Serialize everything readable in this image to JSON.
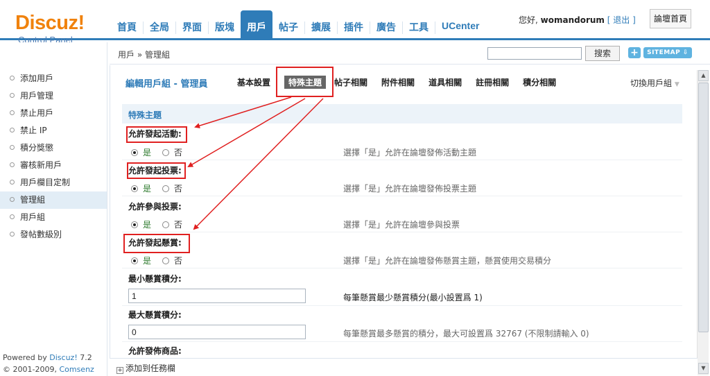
{
  "header": {
    "logo_main": "Discuz!",
    "logo_sub": "Control Panel",
    "nav": [
      "首頁",
      "全局",
      "界面",
      "版塊",
      "用戶",
      "帖子",
      "擴展",
      "插件",
      "廣告",
      "工具",
      "UCenter"
    ],
    "greeting": "您好,",
    "username": "womandorum",
    "logout": "[ 退出 ]",
    "home_button": "論壇首頁"
  },
  "subbar": {
    "breadcrumb": "用戶 » 管理組",
    "search_button": "搜索",
    "plus_button": "+",
    "sitemap_button": "SITEMAP ⇩"
  },
  "sidebar": {
    "items": [
      "添加用戶",
      "用戶管理",
      "禁止用戶",
      "禁止 IP",
      "積分獎懲",
      "審核新用戶",
      "用戶欄目定制",
      "管理組",
      "用戶組",
      "發帖數級別"
    ],
    "powered_prefix": "Powered by",
    "powered_link": "Discuz!",
    "powered_version": "7.2",
    "copyright_prefix": "© 2001-2009,",
    "copyright_link": "Comsenz Inc."
  },
  "main": {
    "group_title": "編輯用戶組 - 管理員",
    "tabs": [
      "基本設置",
      "特殊主題",
      "帖子相關",
      "附件相關",
      "道具相關",
      "註冊相關",
      "積分相關"
    ],
    "switch_group": "切換用戶組",
    "section_title": "特殊主題",
    "yes": "是",
    "no": "否",
    "rows": [
      {
        "label": "允許發起活動:",
        "desc": "選擇「是」允許在論壇發佈活動主題"
      },
      {
        "label": "允許發起投票:",
        "desc": "選擇「是」允許在論壇發佈投票主題"
      },
      {
        "label": "允許參與投票:",
        "desc": "選擇「是」允許在論壇參與投票"
      },
      {
        "label": "允許發起懸賞:",
        "desc": "選擇「是」允許在論壇發佈懸賞主題，懸賞使用交易積分"
      },
      {
        "label": "最小懸賞積分:",
        "value": "1",
        "desc": "每筆懸賞最少懸賞積分(最小設置爲 1)"
      },
      {
        "label": "最大懸賞積分:",
        "value": "0",
        "desc": "每筆懸賞最多懸賞的積分，最大可設置爲 32767 (不限制請輸入 0)"
      },
      {
        "label": "允許發佈商品:"
      }
    ]
  },
  "bottom": {
    "add_task": "添加到任務欄"
  },
  "colors": {
    "accent": "#2f7cb8",
    "logo": "#f0820d",
    "annotation": "#e02020"
  }
}
